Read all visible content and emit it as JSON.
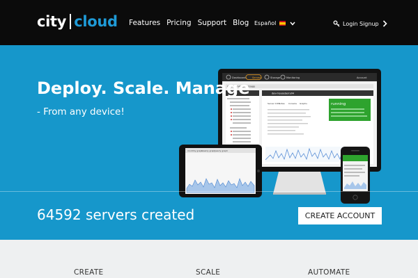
{
  "brand": {
    "city": "city",
    "cloud": "cloud"
  },
  "nav": {
    "items": [
      "Features",
      "Pricing",
      "Support",
      "Blog"
    ]
  },
  "language": {
    "label": "Español"
  },
  "account": {
    "login": "Login",
    "signup": "Signup"
  },
  "hero": {
    "headline": "Deploy. Scale. Manage",
    "subline": "- From any device!",
    "servers_text": "64592 servers created",
    "cta_label": "CREATE ACCOUNT"
  },
  "dashboard": {
    "tabs": [
      "Dashboard",
      "Servers",
      "Storage",
      "Monitoring"
    ],
    "user_label": "Account",
    "sub_tabs": [
      "Cloud servers",
      "Logs",
      "Usage"
    ],
    "server_name": "dev-mouseberry04",
    "status": "running",
    "server_tabs": [
      "Server Info",
      "Notes",
      "Console",
      "Graphs"
    ]
  },
  "tablet": {
    "tabs": [
      "monthly graph",
      "weekly graph",
      "yearly graph"
    ]
  },
  "features": {
    "items": [
      "CREATE",
      "SCALE",
      "AUTOMATE"
    ]
  },
  "colors": {
    "topbar": "#0b0b0b",
    "hero": "#1697cb",
    "accent": "#1f9ad6",
    "status_green": "#2ea32e"
  }
}
